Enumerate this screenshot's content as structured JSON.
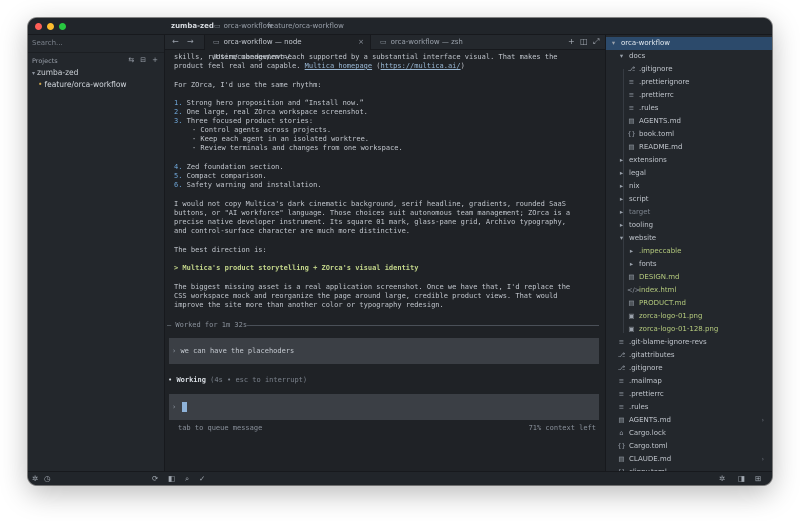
{
  "titlebar": {
    "project": "zumba-zed",
    "repo": "orca-workflow",
    "branch": "feature/orca-workflow"
  },
  "sidebar": {
    "search_placeholder": "Search...",
    "projects_label": "Projects",
    "project_name": "zumba-zed",
    "branch_item": "feature/orca-workflow"
  },
  "tabs": [
    {
      "label": "orca-workflow — node /Users/cubedev/.nvm/..."
    },
    {
      "label": "orca-workflow — zsh"
    }
  ],
  "terminal": {
    "l1": "skills, runtime management—each supported by a substantial interface visual. That makes the",
    "l2_pre": "product feel real and capable. ",
    "l2_link1": "Multica homepage",
    "l2_mid": " (",
    "l2_link2": "https://multica.ai/",
    "l2_post": ")",
    "l3": "For ZOrca, I'd use the same rhythm:",
    "list": [
      {
        "n": "1.",
        "t": "Strong hero proposition and “Install now.”"
      },
      {
        "n": "2.",
        "t": "One large, real ZOrca workspace screenshot."
      },
      {
        "n": "3.",
        "t": "Three focused product stories:"
      }
    ],
    "sub": [
      "- Control agents across projects.",
      "- Keep each agent in an isolated worktree.",
      "- Review terminals and changes from one workspace."
    ],
    "list2": [
      {
        "n": "4.",
        "t": "Zed foundation section."
      },
      {
        "n": "5.",
        "t": "Compact comparison."
      },
      {
        "n": "6.",
        "t": "Safety warning and installation."
      }
    ],
    "p2": [
      "I would not copy Multica's dark cinematic background, serif headline, gradients, rounded SaaS",
      "buttons, or \"AI workforce\" language. Those choices suit autonomous team management; ZOrca is a",
      "precise native developer instrument. Its square 01 mark, glass-pane grid, Archivo typography,",
      "and control-surface character are much more distinctive."
    ],
    "best": "The best direction is:",
    "quote": "> Multica's product storytelling + ZOrca's visual identity",
    "p3": [
      "The biggest missing asset is a real application screenshot. Once we have that, I'd replace the",
      "CSS workspace mock and reorganize the page around large, credible product views. That would",
      "improve the site more than another color or typography redesign."
    ],
    "worked": "— Worked for 1m 32s",
    "user_msg": "we can have the placehoders",
    "working_label": "Working",
    "working_detail": " (4s • esc to interrupt)",
    "hint": "tab to queue message",
    "context": "71% context left"
  },
  "files": [
    {
      "name": "orca-workflow",
      "icon": "folder-open-icon",
      "glyph": "▾",
      "indent": 0,
      "sel": true
    },
    {
      "name": "docs",
      "icon": "folder-open-icon",
      "glyph": "▾",
      "indent": 1
    },
    {
      "name": ".gitignore",
      "icon": "git-icon",
      "glyph": "⎇",
      "indent": 2
    },
    {
      "name": ".prettierignore",
      "icon": "file-icon",
      "glyph": "≡",
      "indent": 2
    },
    {
      "name": ".prettierrc",
      "icon": "file-icon",
      "glyph": "≡",
      "indent": 2
    },
    {
      "name": ".rules",
      "icon": "file-icon",
      "glyph": "≡",
      "indent": 2
    },
    {
      "name": "AGENTS.md",
      "icon": "markdown-icon",
      "glyph": "▤",
      "indent": 2
    },
    {
      "name": "book.toml",
      "icon": "toml-icon",
      "glyph": "{}",
      "indent": 2
    },
    {
      "name": "README.md",
      "icon": "markdown-icon",
      "glyph": "▤",
      "indent": 2
    },
    {
      "name": "extensions",
      "icon": "folder-icon",
      "glyph": "▸",
      "indent": 1
    },
    {
      "name": "legal",
      "icon": "folder-icon",
      "glyph": "▸",
      "indent": 1
    },
    {
      "name": "nix",
      "icon": "folder-icon",
      "glyph": "▸",
      "indent": 1
    },
    {
      "name": "script",
      "icon": "folder-icon",
      "glyph": "▸",
      "indent": 1
    },
    {
      "name": "target",
      "icon": "folder-icon",
      "glyph": "▸",
      "indent": 1,
      "dim": true
    },
    {
      "name": "tooling",
      "icon": "folder-icon",
      "glyph": "▸",
      "indent": 1
    },
    {
      "name": "website",
      "icon": "folder-open-icon",
      "glyph": "▾",
      "indent": 1
    },
    {
      "name": ".impeccable",
      "icon": "folder-icon",
      "glyph": "▸",
      "indent": 2,
      "green": true
    },
    {
      "name": "fonts",
      "icon": "folder-icon",
      "glyph": "▸",
      "indent": 2
    },
    {
      "name": "DESIGN.md",
      "icon": "markdown-icon",
      "glyph": "▤",
      "indent": 2,
      "green": true
    },
    {
      "name": "index.html",
      "icon": "html-icon",
      "glyph": "</>",
      "indent": 2,
      "green": true
    },
    {
      "name": "PRODUCT.md",
      "icon": "markdown-icon",
      "glyph": "▤",
      "indent": 2,
      "green": true
    },
    {
      "name": "zorca-logo-01.png",
      "icon": "image-icon",
      "glyph": "▣",
      "indent": 2,
      "green": true
    },
    {
      "name": "zorca-logo-01-128.png",
      "icon": "image-icon",
      "glyph": "▣",
      "indent": 2,
      "green": true
    },
    {
      "name": ".git-blame-ignore-revs",
      "icon": "file-icon",
      "glyph": "≡",
      "indent": 1
    },
    {
      "name": ".gitattributes",
      "icon": "git-icon",
      "glyph": "⎇",
      "indent": 1
    },
    {
      "name": ".gitignore",
      "icon": "git-icon",
      "glyph": "⎇",
      "indent": 1
    },
    {
      "name": ".mailmap",
      "icon": "file-icon",
      "glyph": "≡",
      "indent": 1
    },
    {
      "name": ".prettierrc",
      "icon": "file-icon",
      "glyph": "≡",
      "indent": 1
    },
    {
      "name": ".rules",
      "icon": "file-icon",
      "glyph": "≡",
      "indent": 1
    },
    {
      "name": "AGENTS.md",
      "icon": "markdown-icon",
      "glyph": "▤",
      "indent": 1,
      "arrow": true
    },
    {
      "name": "Cargo.lock",
      "icon": "lock-icon",
      "glyph": "⌂",
      "indent": 1
    },
    {
      "name": "Cargo.toml",
      "icon": "toml-icon",
      "glyph": "{}",
      "indent": 1
    },
    {
      "name": "CLAUDE.md",
      "icon": "markdown-icon",
      "glyph": "▤",
      "indent": 1,
      "arrow": true
    },
    {
      "name": "clippy.toml",
      "icon": "toml-icon",
      "glyph": "{}",
      "indent": 1
    }
  ]
}
